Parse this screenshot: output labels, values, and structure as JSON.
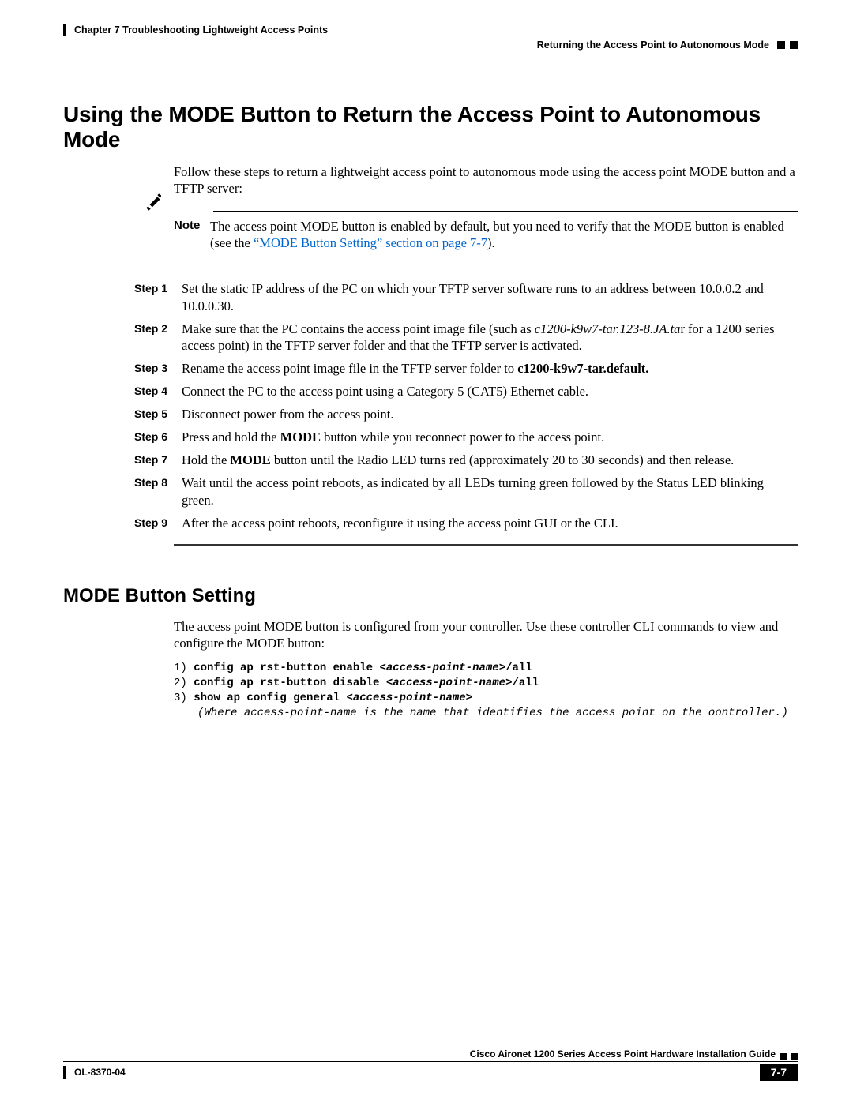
{
  "header": {
    "chapter": "Chapter 7      Troubleshooting Lightweight Access Points",
    "breadcrumb": "Returning the Access Point to Autonomous Mode"
  },
  "section1": {
    "title": "Using the MODE Button to Return the Access Point to Autonomous Mode",
    "intro": "Follow these steps to return a lightweight access point to autonomous mode using the access point MODE button and a TFTP server:",
    "note_label": "Note",
    "note_text_before": "The access point MODE button is enabled by default, but you need to verify that the MODE button is enabled (see the ",
    "note_link": "“MODE Button Setting” section on page 7-7",
    "note_text_after": ")."
  },
  "steps": [
    {
      "label": "Step 1",
      "html": "Set the static IP address of the PC on which your TFTP server software runs to an address between 10.0.0.2 and 10.0.0.30."
    },
    {
      "label": "Step 2",
      "html": "Make sure that the PC contains the access point image file (such as <span class='i'>c1200-k9w7-tar.123-8.JA.ta</span>r for a 1200 series access point) in the TFTP server folder and that the TFTP server is activated."
    },
    {
      "label": "Step 3",
      "html": "Rename the access point image file in the TFTP server folder to <span class='b'>c1200-k9w7-tar.default.</span>"
    },
    {
      "label": "Step 4",
      "html": "Connect the PC to the access point using a Category 5 (CAT5) Ethernet cable."
    },
    {
      "label": "Step 5",
      "html": "Disconnect power from the access point."
    },
    {
      "label": "Step 6",
      "html": "Press and hold the <span class='b'>MODE</span> button while you reconnect power to the access point."
    },
    {
      "label": "Step 7",
      "html": "Hold the <span class='b'>MODE</span> button until the Radio LED turns red (approximately 20 to 30 seconds) and then release."
    },
    {
      "label": "Step 8",
      "html": "Wait until the access point reboots, as indicated by all LEDs turning green followed by the Status LED blinking green."
    },
    {
      "label": "Step 9",
      "html": "After the access point reboots, reconfigure it using the access point GUI or the CLI."
    }
  ],
  "section2": {
    "title": "MODE Button Setting",
    "intro": "The access point MODE button is configured from your controller. Use these controller CLI commands to view and configure the MODE button:",
    "cli": [
      {
        "n": "1)",
        "pre": "config ap rst-button enable ",
        "arg": "<access-point-name>",
        "post": "/all",
        "bold": true
      },
      {
        "n": "2)",
        "pre": "config ap rst-button disable ",
        "arg": "<access-point-name>",
        "post": "/all",
        "bold": true
      },
      {
        "n": "3)",
        "pre": "show ap config general ",
        "arg": "<access-point-name>",
        "post": "",
        "bold": true
      }
    ],
    "cli_note_pre": "(Where ",
    "cli_note_arg": "access-point-name",
    "cli_note_post": " is the name that identifies the access point on the oontroller.)"
  },
  "footer": {
    "guide": "Cisco Aironet 1200 Series Access Point Hardware Installation Guide",
    "doc": "OL-8370-04",
    "page": "7-7"
  }
}
